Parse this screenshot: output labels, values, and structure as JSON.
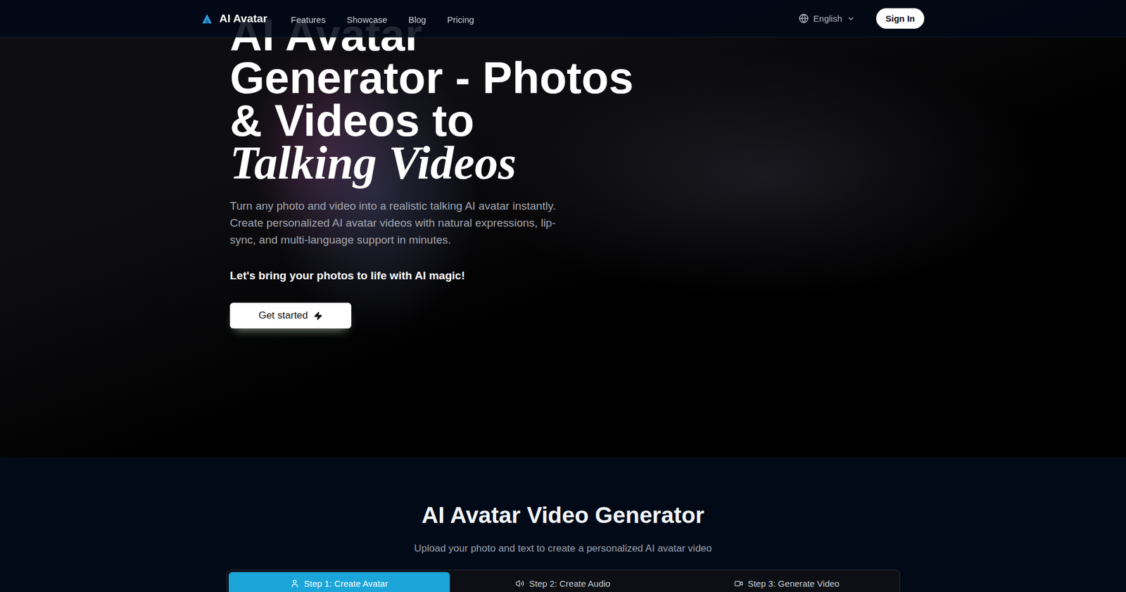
{
  "header": {
    "logo": "AI Avatar",
    "nav": [
      "Features",
      "Showcase",
      "Blog",
      "Pricing"
    ],
    "language": "English",
    "sign_in": "Sign In"
  },
  "hero": {
    "title_lines": [
      "AI Avatar",
      "Generator - Photos",
      "& Videos to"
    ],
    "title_accent": "Talking Videos",
    "description": "Turn any photo and video into a realistic talking AI avatar instantly. Create personalized AI avatar videos with natural expressions, lip-sync, and multi-language support in minutes.",
    "tagline": "Let's bring your photos to life with AI magic!",
    "cta": "Get started"
  },
  "generator": {
    "title": "AI Avatar Video Generator",
    "subtitle": "Upload your photo and text to create a personalized AI avatar video",
    "steps": [
      {
        "label": "Step 1: Create Avatar",
        "selected": true,
        "kind": "avatar"
      },
      {
        "label": "Step 2: Create Audio",
        "selected": false,
        "kind": "audio"
      },
      {
        "label": "Step 3: Generate Video",
        "selected": false,
        "kind": "video"
      }
    ]
  }
}
